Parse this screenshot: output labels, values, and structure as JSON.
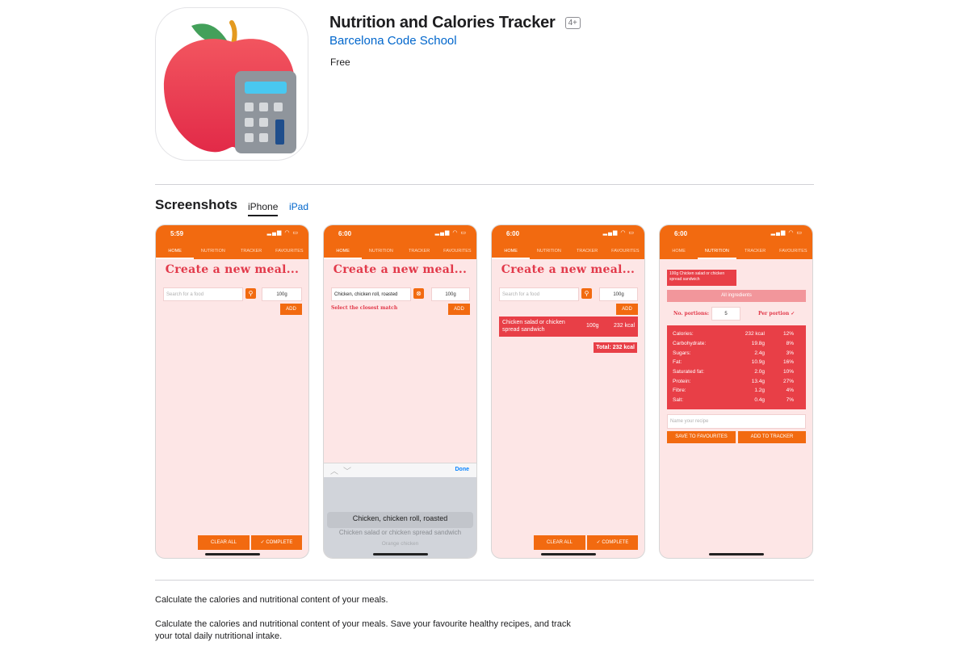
{
  "app": {
    "title": "Nutrition and Calories Tracker",
    "age_rating": "4+",
    "developer": "Barcelona Code School",
    "price": "Free"
  },
  "screenshots": {
    "heading": "Screenshots",
    "tabs": [
      {
        "label": "iPhone",
        "active": true
      },
      {
        "label": "iPad",
        "active": false
      }
    ]
  },
  "phones": [
    {
      "time": "5:59",
      "nav": [
        "HOME",
        "NUTRITION",
        "TRACKER",
        "FAVOURITES"
      ],
      "headline": "Create a new meal...",
      "search_placeholder": "Search for a food",
      "qty": "100g",
      "add": "ADD",
      "clear": "CLEAR ALL",
      "complete": "✓ COMPLETE"
    },
    {
      "time": "6:00",
      "nav": [
        "HOME",
        "NUTRITION",
        "TRACKER",
        "FAVOURITES"
      ],
      "headline": "Create a new meal...",
      "search_value": "Chicken, chicken roll, roasted",
      "qty": "100g",
      "add": "ADD",
      "match": "Select the closest match",
      "done": "Done",
      "picker": [
        "Chicken, chicken roll, roasted",
        "Chicken salad or chicken spread sandwich",
        "Orange chicken"
      ]
    },
    {
      "time": "6:00",
      "nav": [
        "HOME",
        "NUTRITION",
        "TRACKER",
        "FAVOURITES"
      ],
      "headline": "Create a new meal...",
      "search_placeholder": "Search for a food",
      "qty": "100g",
      "add": "ADD",
      "meal_name": "Chicken salad or chicken spread sandwich",
      "meal_qty": "100g",
      "meal_kcal": "232 kcal",
      "total": "Total: 232 kcal",
      "clear": "CLEAR ALL",
      "complete": "✓ COMPLETE"
    },
    {
      "time": "6:00",
      "nav": [
        "HOME",
        "NUTRITION",
        "TRACKER",
        "FAVOURITES"
      ],
      "tag": "100g Chicken salad or chicken spread sandwich",
      "all_ingredients": "All ingredients",
      "portions_label": "No. portions:",
      "portions_value": "5",
      "per_portion": "Per portion ✓",
      "nutrients": [
        {
          "name": "Calories:",
          "amount": "232 kcal",
          "pct": "12%"
        },
        {
          "name": "Carbohydrate:",
          "amount": "19.8g",
          "pct": "8%"
        },
        {
          "name": "Sugars:",
          "amount": "2.4g",
          "pct": "3%"
        },
        {
          "name": "Fat:",
          "amount": "10.9g",
          "pct": "16%"
        },
        {
          "name": "Saturated fat:",
          "amount": "2.0g",
          "pct": "10%"
        },
        {
          "name": "Protein:",
          "amount": "13.4g",
          "pct": "27%"
        },
        {
          "name": "Fibre:",
          "amount": "1.2g",
          "pct": "4%"
        },
        {
          "name": "Salt:",
          "amount": "0.4g",
          "pct": "7%"
        }
      ],
      "recipe_placeholder": "Name your recipe",
      "save_fav": "SAVE TO FAVOURITES",
      "add_tracker": "ADD TO TRACKER"
    }
  ],
  "description": {
    "short": "Calculate the calories and nutritional content of your meals.",
    "long_line1": "Calculate the calories and nutritional content of your meals. Save your favourite healthy recipes, and track",
    "long_line2": "your total daily nutritional intake."
  },
  "colors": {
    "accent": "#f26a10",
    "red": "#e83f47",
    "link": "#0066cc",
    "screen_bg": "#fde6e6"
  }
}
